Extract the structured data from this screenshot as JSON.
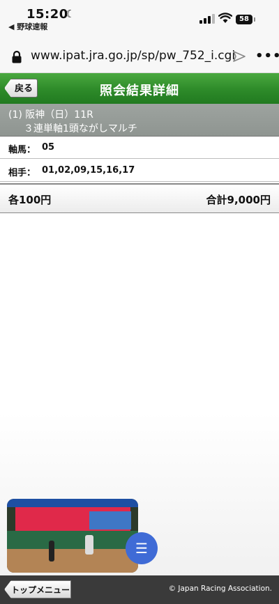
{
  "status_bar": {
    "time": "15:20",
    "back_app": "◀ 野球速報",
    "battery": "58"
  },
  "browser": {
    "url": "www.ipat.jra.go.jp/sp/pw_752_i.cgi"
  },
  "header": {
    "back_label": "戻る",
    "title": "照会結果詳細",
    "color": "#2d8a29"
  },
  "race": {
    "line1": "(1) 阪神（日）11R",
    "line2": "３連単軸1頭ながしマルチ"
  },
  "details": {
    "axis_label": "軸馬：",
    "axis_value": "05",
    "partner_label": "相手：",
    "partner_value": "01,02,09,15,16,17",
    "each": "各100円",
    "total": "合計9,000円"
  },
  "footer": {
    "top_menu_label": "トップメニュー",
    "copyright": "© Japan Racing Association."
  },
  "icons": {
    "fab": "menu-icon",
    "lock": "lock-icon",
    "share": "share-icon"
  }
}
